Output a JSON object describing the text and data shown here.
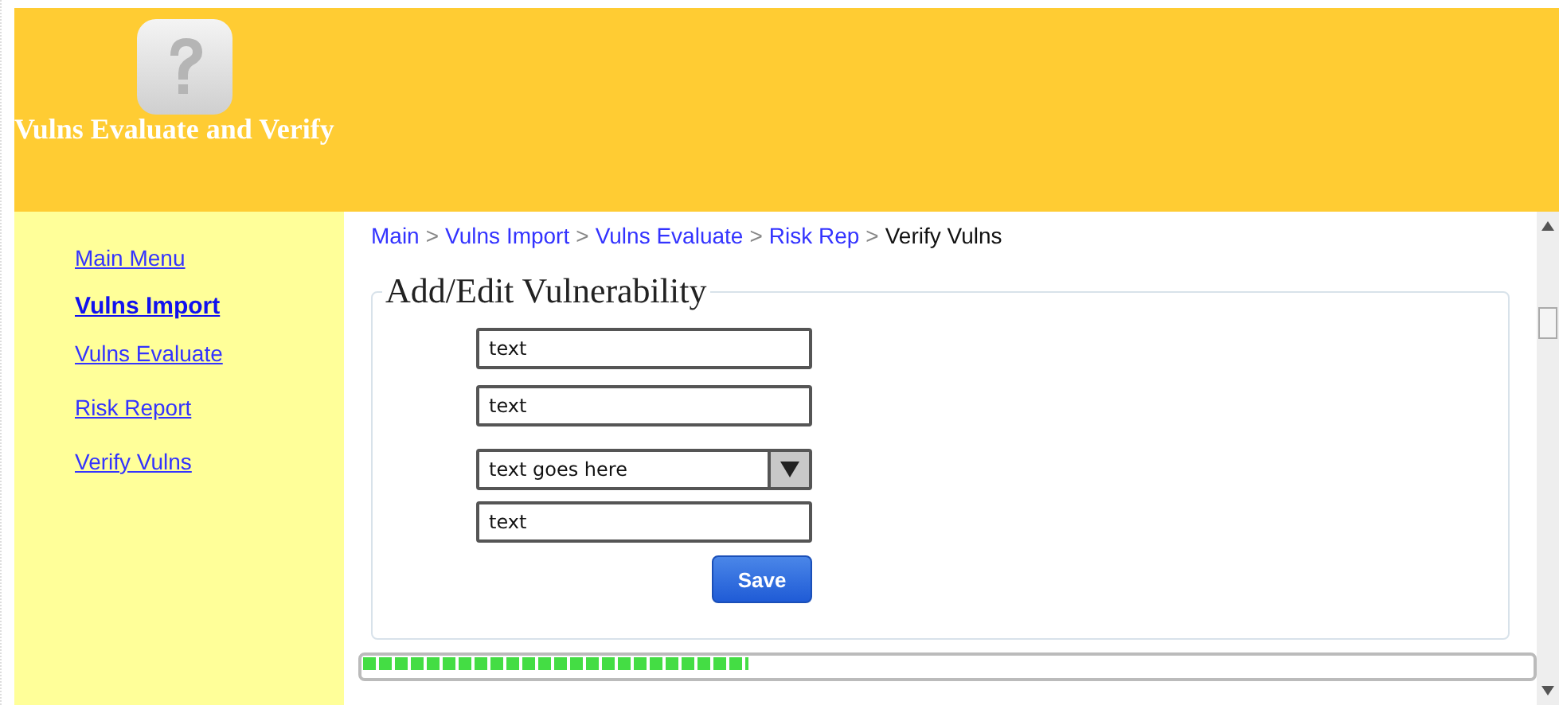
{
  "header": {
    "title": "Vulns Evaluate and Verify"
  },
  "sidebar": {
    "items": [
      {
        "label": "Main Menu",
        "selected": false
      },
      {
        "label": "Vulns Import",
        "selected": true
      },
      {
        "label": "Vulns Evaluate",
        "selected": false
      },
      {
        "label": "Risk Report",
        "selected": false
      },
      {
        "label": "Verify Vulns",
        "selected": false
      }
    ]
  },
  "breadcrumb": [
    {
      "label": "Main",
      "kind": "link"
    },
    {
      "label": "Vulns Import",
      "kind": "link"
    },
    {
      "label": "Vulns Evaluate",
      "kind": "link"
    },
    {
      "label": "Risk Rep",
      "kind": "link"
    },
    {
      "label": "Verify Vulns",
      "kind": "current"
    }
  ],
  "separator": ">",
  "form": {
    "legend": "Add/Edit Vulnerability",
    "fields": [
      {
        "kind": "text",
        "value": "text"
      },
      {
        "kind": "text",
        "value": "text"
      },
      {
        "kind": "select",
        "value": "text goes here"
      },
      {
        "kind": "text",
        "value": "text"
      }
    ],
    "button": "Save"
  },
  "progress": {
    "level": 0.33
  }
}
